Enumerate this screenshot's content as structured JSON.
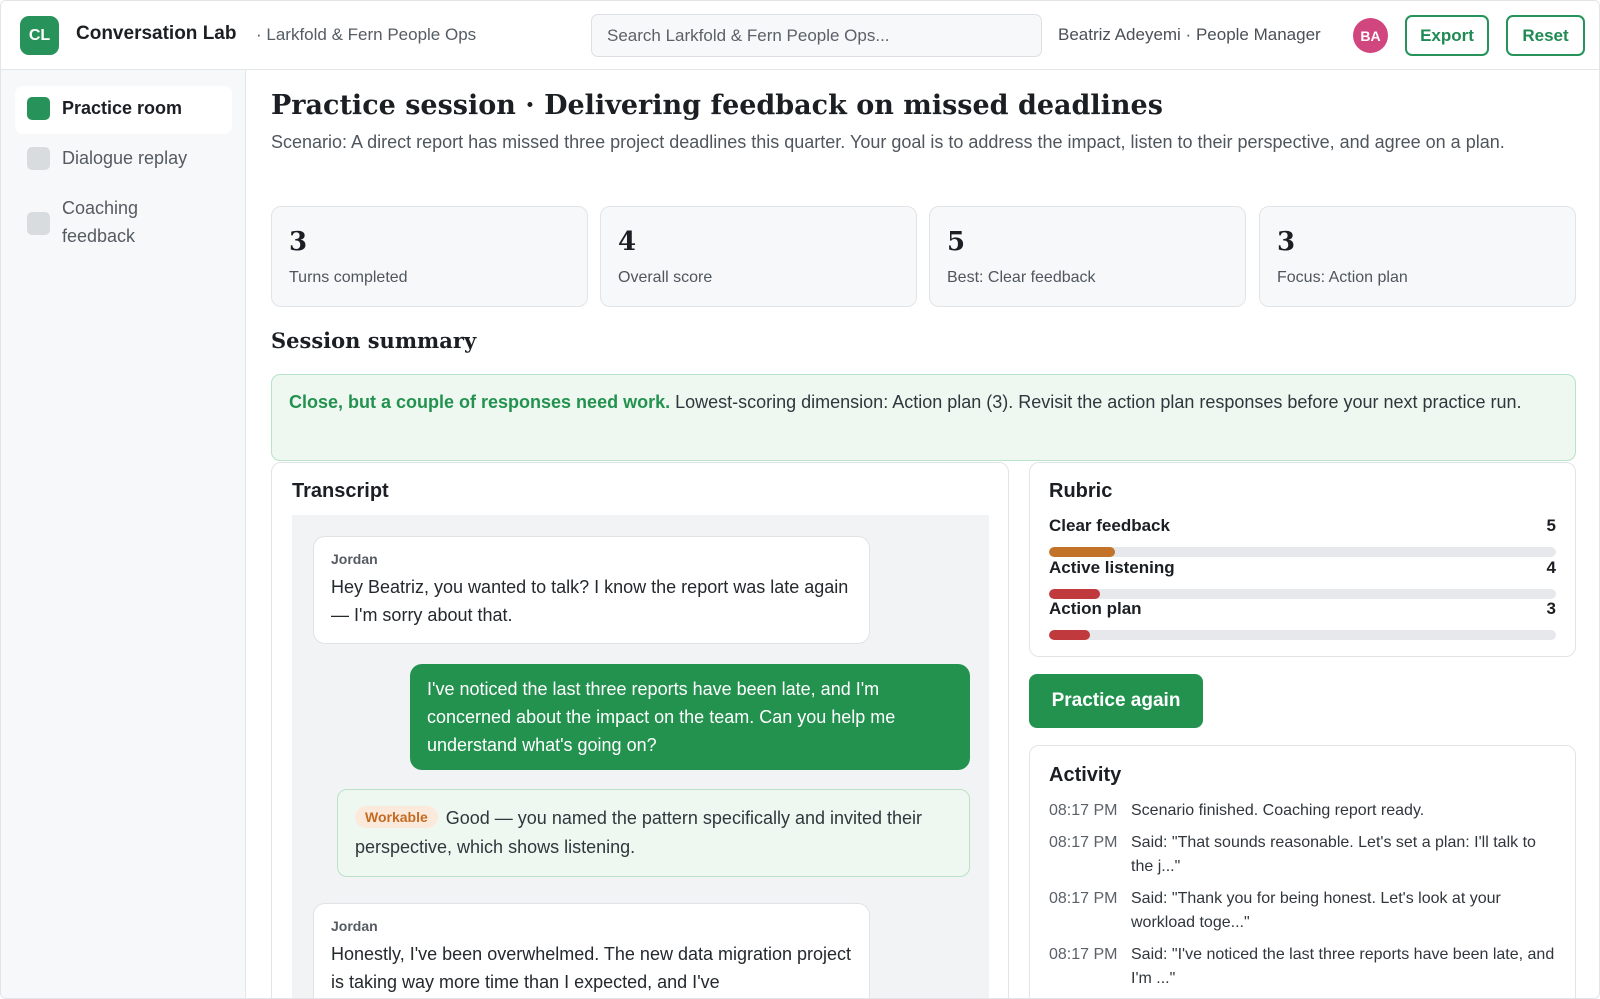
{
  "header": {
    "logo_text": "CL",
    "app_name": "Conversation Lab",
    "org_name": "· Larkfold & Fern People Ops",
    "search_placeholder": "Search Larkfold & Fern People Ops...",
    "user_label": "Beatriz Adeyemi · People Manager",
    "avatar_initials": "BA",
    "export_label": "Export",
    "reset_label": "Reset"
  },
  "sidebar": {
    "items": [
      {
        "label": "Practice room",
        "active": true
      },
      {
        "label": "Dialogue replay",
        "active": false
      },
      {
        "label": "Coaching feedback",
        "active": false
      }
    ]
  },
  "page": {
    "title": "Practice session · Delivering feedback on missed deadlines",
    "scenario": "Scenario: A direct report has missed three project deadlines this quarter. Your goal is to address the impact, listen to their perspective, and agree on a plan."
  },
  "stats": [
    {
      "value": "3",
      "label": "Turns completed"
    },
    {
      "value": "4",
      "label": "Overall score"
    },
    {
      "value": "5",
      "label": "Best: Clear feedback"
    },
    {
      "value": "3",
      "label": "Focus: Action plan"
    }
  ],
  "summary": {
    "title": "Session summary",
    "headline": "Close, but a couple of responses need work.",
    "text": " Lowest-scoring dimension: Action plan (3). Revisit the action plan responses before your next practice run."
  },
  "transcript": {
    "title": "Transcript",
    "messages": [
      {
        "from": "Jordan",
        "text": "Hey Beatriz, you wanted to talk? I know the report was late again — I'm sorry about that."
      },
      {
        "text": "I've noticed the last three reports have been late, and I'm concerned about the impact on the team. Can you help me understand what's going on?"
      },
      {
        "tag": "Workable",
        "text": "Good — you named the pattern specifically and invited their perspective, which shows listening."
      },
      {
        "from": "Jordan",
        "text": "Honestly, I've been overwhelmed. The new data migration project is taking way more time than I expected, and I've"
      }
    ]
  },
  "rubric": {
    "title": "Rubric",
    "items": [
      {
        "name": "Clear feedback",
        "score": "5",
        "fill_fraction": 0.13,
        "color": "#c27327"
      },
      {
        "name": "Active listening",
        "score": "4",
        "fill_fraction": 0.1,
        "color": "#c0393c"
      },
      {
        "name": "Action plan",
        "score": "3",
        "fill_fraction": 0.08,
        "color": "#c0393c"
      }
    ]
  },
  "practice_again_label": "Practice again",
  "activity": {
    "title": "Activity",
    "items": [
      {
        "time": "08:17 PM",
        "text": "Scenario finished. Coaching report ready."
      },
      {
        "time": "08:17 PM",
        "text": "Said: \"That sounds reasonable. Let's set a plan: I'll talk to the j...\""
      },
      {
        "time": "08:17 PM",
        "text": "Said: \"Thank you for being honest. Let's look at your workload toge...\""
      },
      {
        "time": "08:17 PM",
        "text": "Said: \"I've noticed the last three reports have been late, and I'm ...\""
      }
    ]
  }
}
